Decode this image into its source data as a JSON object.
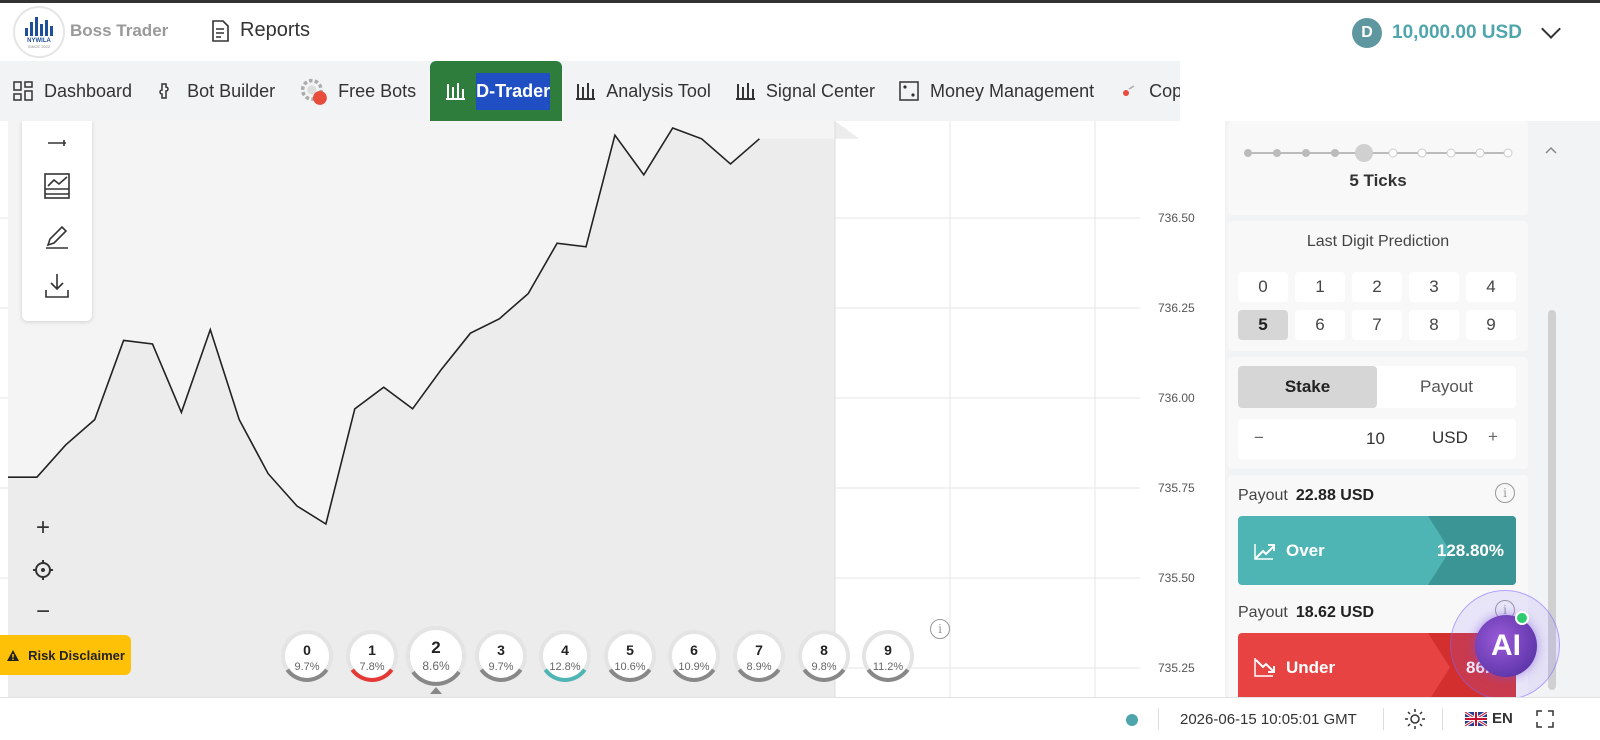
{
  "header": {
    "logo_text": "NYWILA",
    "logo_sub": "SINCE 2022",
    "brand": "Boss Trader",
    "reports_label": "Reports",
    "balance": "10,000.00 USD",
    "coin_symbol": "D"
  },
  "nav": {
    "items": [
      {
        "label": "Dashboard",
        "icon": "dashboard-grid-icon"
      },
      {
        "label": "Bot Builder",
        "icon": "puzzle-icon"
      },
      {
        "label": "Free Bots",
        "icon": "gear-badge-icon"
      },
      {
        "label": "D-Trader",
        "icon": "candles-icon",
        "active": true
      },
      {
        "label": "Analysis Tool",
        "icon": "candles-icon"
      },
      {
        "label": "Signal Center",
        "icon": "candles-icon"
      },
      {
        "label": "Money Management",
        "icon": "dice-icon"
      },
      {
        "label": "Cop",
        "icon": "copy-trading-icon"
      }
    ]
  },
  "chart": {
    "price_ticks": [
      "736.50",
      "736.25",
      "736.00",
      "735.75",
      "735.50",
      "735.25"
    ],
    "colors": {
      "line": "#222222",
      "fill": "#ececec",
      "grid": "#e6e6e6"
    }
  },
  "chart_data": {
    "type": "area",
    "title": "",
    "xlabel": "",
    "ylabel": "",
    "ylim": [
      735.15,
      736.62
    ],
    "x": [
      1,
      2,
      3,
      4,
      5,
      6,
      7,
      8,
      9,
      10,
      11,
      12,
      13,
      14,
      15,
      16,
      17,
      18,
      19,
      20,
      21,
      22,
      23,
      24,
      25,
      26,
      27
    ],
    "values": [
      735.78,
      735.78,
      735.87,
      735.94,
      736.16,
      736.15,
      735.96,
      736.19,
      735.94,
      735.79,
      735.7,
      735.65,
      735.97,
      736.03,
      735.97,
      736.08,
      736.18,
      736.22,
      736.29,
      736.43,
      736.42,
      736.73,
      736.62,
      736.75,
      736.72,
      736.65,
      736.72
    ],
    "digit_stats": [
      {
        "digit": "0",
        "percent": "9.7%"
      },
      {
        "digit": "1",
        "percent": "7.8%"
      },
      {
        "digit": "2",
        "percent": "8.6%"
      },
      {
        "digit": "3",
        "percent": "9.7%"
      },
      {
        "digit": "4",
        "percent": "12.8%"
      },
      {
        "digit": "5",
        "percent": "10.6%"
      },
      {
        "digit": "6",
        "percent": "10.9%"
      },
      {
        "digit": "7",
        "percent": "8.9%"
      },
      {
        "digit": "8",
        "percent": "9.8%"
      },
      {
        "digit": "9",
        "percent": "11.2%"
      }
    ]
  },
  "risk_disclaimer": "Risk Disclaimer",
  "trade": {
    "duration_label": "5 Ticks",
    "ldp_title": "Last Digit Prediction",
    "digits": [
      "0",
      "1",
      "2",
      "3",
      "4",
      "5",
      "6",
      "7",
      "8",
      "9"
    ],
    "selected_digit": "5",
    "stake_tab": "Stake",
    "payout_tab": "Payout",
    "minus": "−",
    "plus": "+",
    "stake_value": "10",
    "currency": "USD",
    "over": {
      "payout_label": "Payout",
      "payout_value": "22.88 USD",
      "button_label": "Over",
      "percent": "128.80%",
      "color": "#4fb4b4"
    },
    "under": {
      "payout_label": "Payout",
      "payout_value": "18.62 USD",
      "button_label": "Under",
      "percent": "86.",
      "color": "#e53935"
    }
  },
  "ai_label": "AI",
  "footer": {
    "datetime": "2026-06-15 10:05:01 GMT",
    "language": "EN"
  }
}
